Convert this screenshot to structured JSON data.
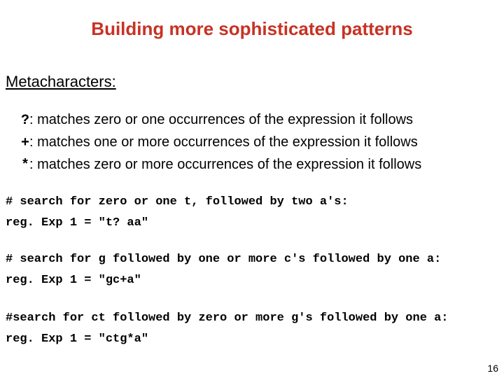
{
  "title": "Building more sophisticated patterns",
  "subhead": "Metacharacters:",
  "meta": {
    "q": {
      "sym": "?",
      "desc": ": matches zero or one occurrences of the expression it follows"
    },
    "p": {
      "sym": "+",
      "desc": ": matches one or more occurrences of the expression it follows"
    },
    "s": {
      "sym": "*",
      "desc": ": matches zero or more occurrences of the expression it follows"
    }
  },
  "code1": {
    "comment": "# search for zero or one t, followed by two a's:",
    "expr": "reg. Exp 1 = \"t? aa\""
  },
  "code2": {
    "comment": "# search for g followed by one or more c's followed by one a:",
    "expr": "reg. Exp 1 = \"gc+a\""
  },
  "code3": {
    "comment": "#search for ct followed by zero or more g's followed by one a:",
    "expr": "reg. Exp 1 = \"ctg*a\""
  },
  "slidenum": "16"
}
